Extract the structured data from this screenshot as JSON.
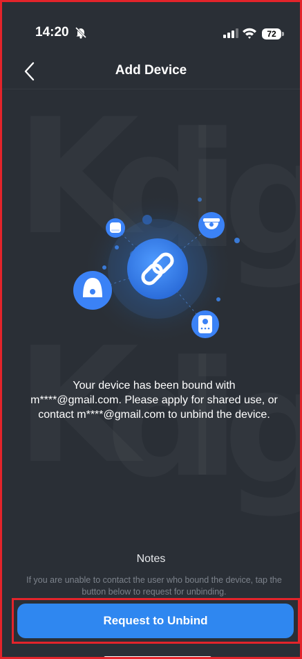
{
  "status_bar": {
    "time": "14:20",
    "battery": "72"
  },
  "navbar": {
    "title": "Add Device"
  },
  "main": {
    "description": "Your device has been bound with m****@gmail.com. Please apply for shared use, or contact m****@gmail.com to unbind the device.",
    "notes_title": "Notes",
    "notes_text": "If you are unable to contact the user who bound the device, tap the button below to request for unbinding.",
    "button_label": "Request to Unbind"
  },
  "watermark": [
    "K",
    "d",
    "i",
    "g",
    "K",
    "d",
    "i",
    "g"
  ],
  "icons": {
    "back": "chevron-left-icon",
    "center": "link-icon",
    "hub": "hub-icon",
    "dome": "dome-camera-icon",
    "sensor": "sensor-icon",
    "doorbell": "doorbell-icon",
    "mute": "bell-slash-icon",
    "signal": "signal-icon",
    "wifi": "wifi-icon"
  },
  "colors": {
    "background": "#2a2f36",
    "accent": "#2f87f0",
    "highlight_border": "#e3242b",
    "muted_text": "#7d838c"
  }
}
